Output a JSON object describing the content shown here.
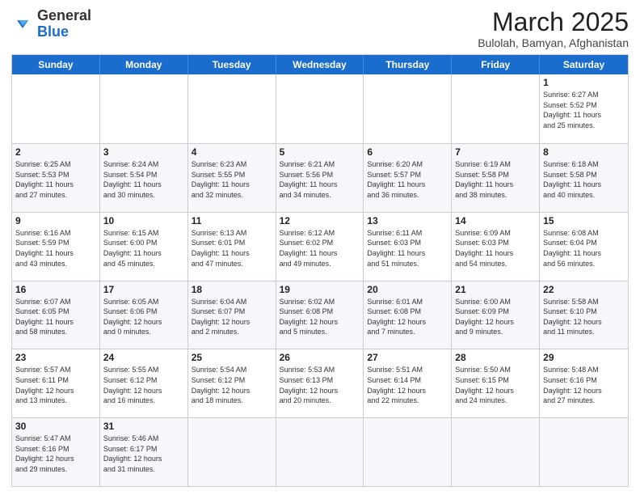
{
  "header": {
    "logo_general": "General",
    "logo_blue": "Blue",
    "title": "March 2025",
    "subtitle": "Bulolah, Bamyan, Afghanistan"
  },
  "days_of_week": [
    "Sunday",
    "Monday",
    "Tuesday",
    "Wednesday",
    "Thursday",
    "Friday",
    "Saturday"
  ],
  "weeks": [
    [
      {
        "day": "",
        "info": ""
      },
      {
        "day": "",
        "info": ""
      },
      {
        "day": "",
        "info": ""
      },
      {
        "day": "",
        "info": ""
      },
      {
        "day": "",
        "info": ""
      },
      {
        "day": "",
        "info": ""
      },
      {
        "day": "1",
        "info": "Sunrise: 6:27 AM\nSunset: 5:52 PM\nDaylight: 11 hours\nand 25 minutes."
      }
    ],
    [
      {
        "day": "2",
        "info": "Sunrise: 6:25 AM\nSunset: 5:53 PM\nDaylight: 11 hours\nand 27 minutes."
      },
      {
        "day": "3",
        "info": "Sunrise: 6:24 AM\nSunset: 5:54 PM\nDaylight: 11 hours\nand 30 minutes."
      },
      {
        "day": "4",
        "info": "Sunrise: 6:23 AM\nSunset: 5:55 PM\nDaylight: 11 hours\nand 32 minutes."
      },
      {
        "day": "5",
        "info": "Sunrise: 6:21 AM\nSunset: 5:56 PM\nDaylight: 11 hours\nand 34 minutes."
      },
      {
        "day": "6",
        "info": "Sunrise: 6:20 AM\nSunset: 5:57 PM\nDaylight: 11 hours\nand 36 minutes."
      },
      {
        "day": "7",
        "info": "Sunrise: 6:19 AM\nSunset: 5:58 PM\nDaylight: 11 hours\nand 38 minutes."
      },
      {
        "day": "8",
        "info": "Sunrise: 6:18 AM\nSunset: 5:58 PM\nDaylight: 11 hours\nand 40 minutes."
      }
    ],
    [
      {
        "day": "9",
        "info": "Sunrise: 6:16 AM\nSunset: 5:59 PM\nDaylight: 11 hours\nand 43 minutes."
      },
      {
        "day": "10",
        "info": "Sunrise: 6:15 AM\nSunset: 6:00 PM\nDaylight: 11 hours\nand 45 minutes."
      },
      {
        "day": "11",
        "info": "Sunrise: 6:13 AM\nSunset: 6:01 PM\nDaylight: 11 hours\nand 47 minutes."
      },
      {
        "day": "12",
        "info": "Sunrise: 6:12 AM\nSunset: 6:02 PM\nDaylight: 11 hours\nand 49 minutes."
      },
      {
        "day": "13",
        "info": "Sunrise: 6:11 AM\nSunset: 6:03 PM\nDaylight: 11 hours\nand 51 minutes."
      },
      {
        "day": "14",
        "info": "Sunrise: 6:09 AM\nSunset: 6:03 PM\nDaylight: 11 hours\nand 54 minutes."
      },
      {
        "day": "15",
        "info": "Sunrise: 6:08 AM\nSunset: 6:04 PM\nDaylight: 11 hours\nand 56 minutes."
      }
    ],
    [
      {
        "day": "16",
        "info": "Sunrise: 6:07 AM\nSunset: 6:05 PM\nDaylight: 11 hours\nand 58 minutes."
      },
      {
        "day": "17",
        "info": "Sunrise: 6:05 AM\nSunset: 6:06 PM\nDaylight: 12 hours\nand 0 minutes."
      },
      {
        "day": "18",
        "info": "Sunrise: 6:04 AM\nSunset: 6:07 PM\nDaylight: 12 hours\nand 2 minutes."
      },
      {
        "day": "19",
        "info": "Sunrise: 6:02 AM\nSunset: 6:08 PM\nDaylight: 12 hours\nand 5 minutes."
      },
      {
        "day": "20",
        "info": "Sunrise: 6:01 AM\nSunset: 6:08 PM\nDaylight: 12 hours\nand 7 minutes."
      },
      {
        "day": "21",
        "info": "Sunrise: 6:00 AM\nSunset: 6:09 PM\nDaylight: 12 hours\nand 9 minutes."
      },
      {
        "day": "22",
        "info": "Sunrise: 5:58 AM\nSunset: 6:10 PM\nDaylight: 12 hours\nand 11 minutes."
      }
    ],
    [
      {
        "day": "23",
        "info": "Sunrise: 5:57 AM\nSunset: 6:11 PM\nDaylight: 12 hours\nand 13 minutes."
      },
      {
        "day": "24",
        "info": "Sunrise: 5:55 AM\nSunset: 6:12 PM\nDaylight: 12 hours\nand 16 minutes."
      },
      {
        "day": "25",
        "info": "Sunrise: 5:54 AM\nSunset: 6:12 PM\nDaylight: 12 hours\nand 18 minutes."
      },
      {
        "day": "26",
        "info": "Sunrise: 5:53 AM\nSunset: 6:13 PM\nDaylight: 12 hours\nand 20 minutes."
      },
      {
        "day": "27",
        "info": "Sunrise: 5:51 AM\nSunset: 6:14 PM\nDaylight: 12 hours\nand 22 minutes."
      },
      {
        "day": "28",
        "info": "Sunrise: 5:50 AM\nSunset: 6:15 PM\nDaylight: 12 hours\nand 24 minutes."
      },
      {
        "day": "29",
        "info": "Sunrise: 5:48 AM\nSunset: 6:16 PM\nDaylight: 12 hours\nand 27 minutes."
      }
    ],
    [
      {
        "day": "30",
        "info": "Sunrise: 5:47 AM\nSunset: 6:16 PM\nDaylight: 12 hours\nand 29 minutes."
      },
      {
        "day": "31",
        "info": "Sunrise: 5:46 AM\nSunset: 6:17 PM\nDaylight: 12 hours\nand 31 minutes."
      },
      {
        "day": "",
        "info": ""
      },
      {
        "day": "",
        "info": ""
      },
      {
        "day": "",
        "info": ""
      },
      {
        "day": "",
        "info": ""
      },
      {
        "day": "",
        "info": ""
      }
    ]
  ]
}
